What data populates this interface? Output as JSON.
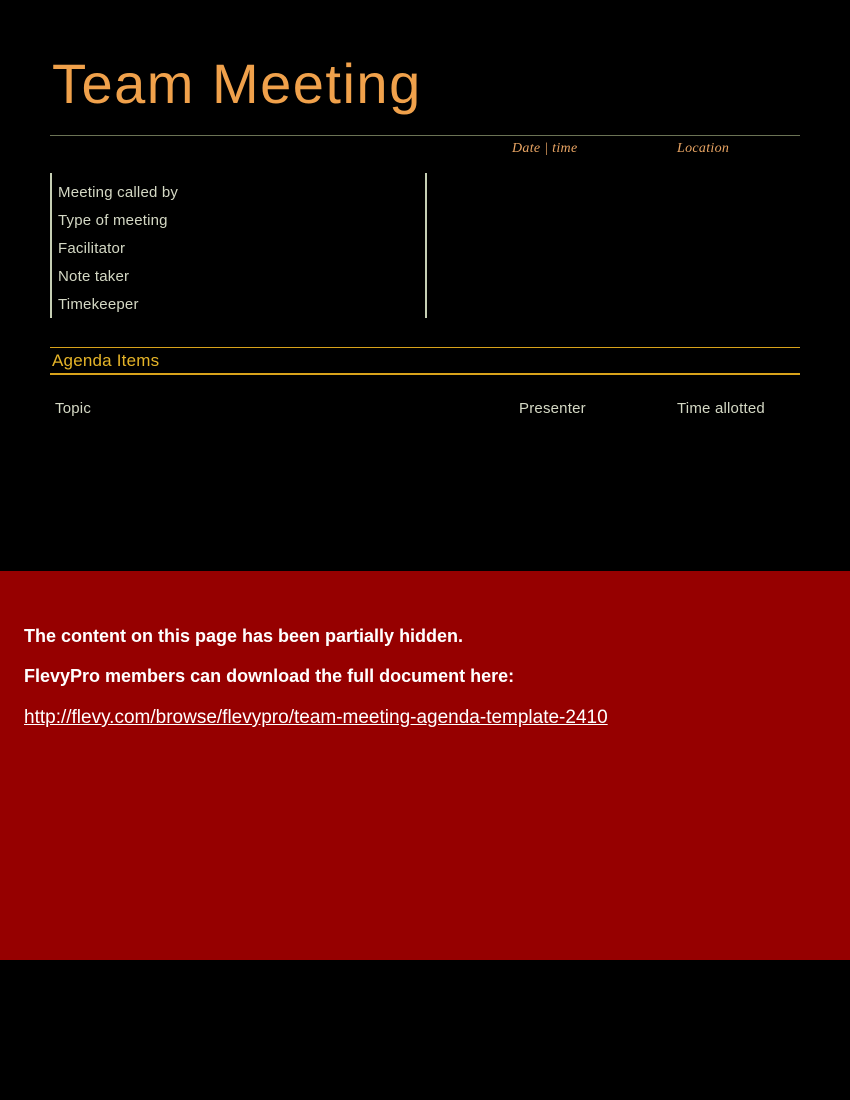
{
  "document": {
    "title": "Team Meeting",
    "background_color": "#000000",
    "title_color": "#F0A14B"
  },
  "header": {
    "date_time_label": "Date | time",
    "location_label": "Location",
    "rule_color": "#6B7355"
  },
  "info": {
    "rows": [
      {
        "label": "Meeting called by"
      },
      {
        "label": "Type of meeting"
      },
      {
        "label": "Facilitator"
      },
      {
        "label": "Note taker"
      },
      {
        "label": "Timekeeper"
      }
    ],
    "divider_color": "#C6CFB4",
    "label_color": "#D4D8C4"
  },
  "agenda": {
    "section_title": "Agenda Items",
    "accent_color": "#D9A31B",
    "columns": [
      {
        "label": "Topic"
      },
      {
        "label": "Presenter"
      },
      {
        "label": "Time allotted"
      }
    ]
  },
  "notice": {
    "background_color": "#960000",
    "line1": "The content on this page has been partially hidden.",
    "line2": "FlevyPro members can download the full document here:",
    "link_text": "http://flevy.com/browse/flevypro/team-meeting-agenda-template-2410"
  }
}
